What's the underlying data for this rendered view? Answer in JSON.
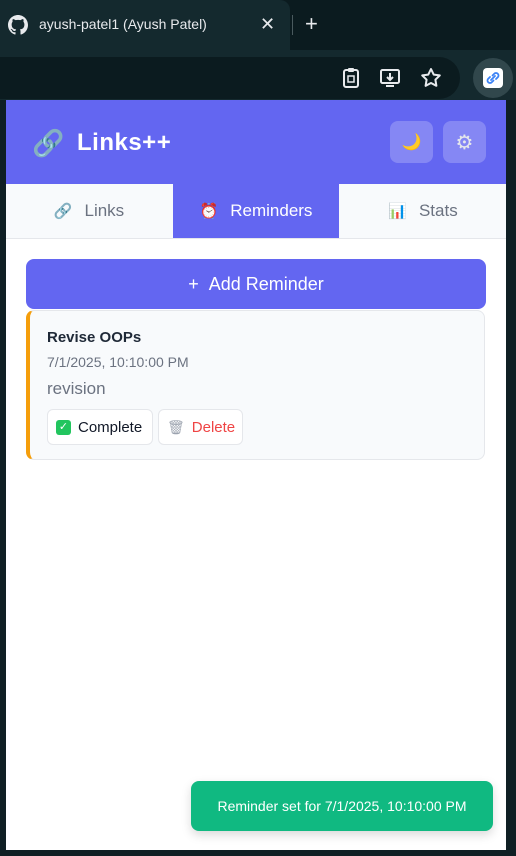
{
  "browser": {
    "tab_title": "ayush-patel1 (Ayush Patel)",
    "tab_close": "✕",
    "new_tab": "+"
  },
  "app": {
    "title": "Links++",
    "logo_icon": "🔗",
    "theme_icon": "🌙",
    "settings_icon": "⚙"
  },
  "tabs": [
    {
      "label": "Links",
      "icon": "🔗"
    },
    {
      "label": "Reminders",
      "icon": "⏰"
    },
    {
      "label": "Stats",
      "icon": "📊"
    }
  ],
  "active_tab": "Reminders",
  "add_button": {
    "icon": "+",
    "label": "Add Reminder"
  },
  "reminders": [
    {
      "title": "Revise OOPs",
      "time": "7/1/2025, 10:10:00 PM",
      "description": "revision",
      "complete_label": "Complete",
      "delete_label": "Delete"
    }
  ],
  "toast": "Reminder set for 7/1/2025, 10:10:00 PM",
  "colors": {
    "accent": "#6366f1",
    "reminder_border": "#f59e0b",
    "toast": "#10b981",
    "delete": "#ef4444"
  }
}
